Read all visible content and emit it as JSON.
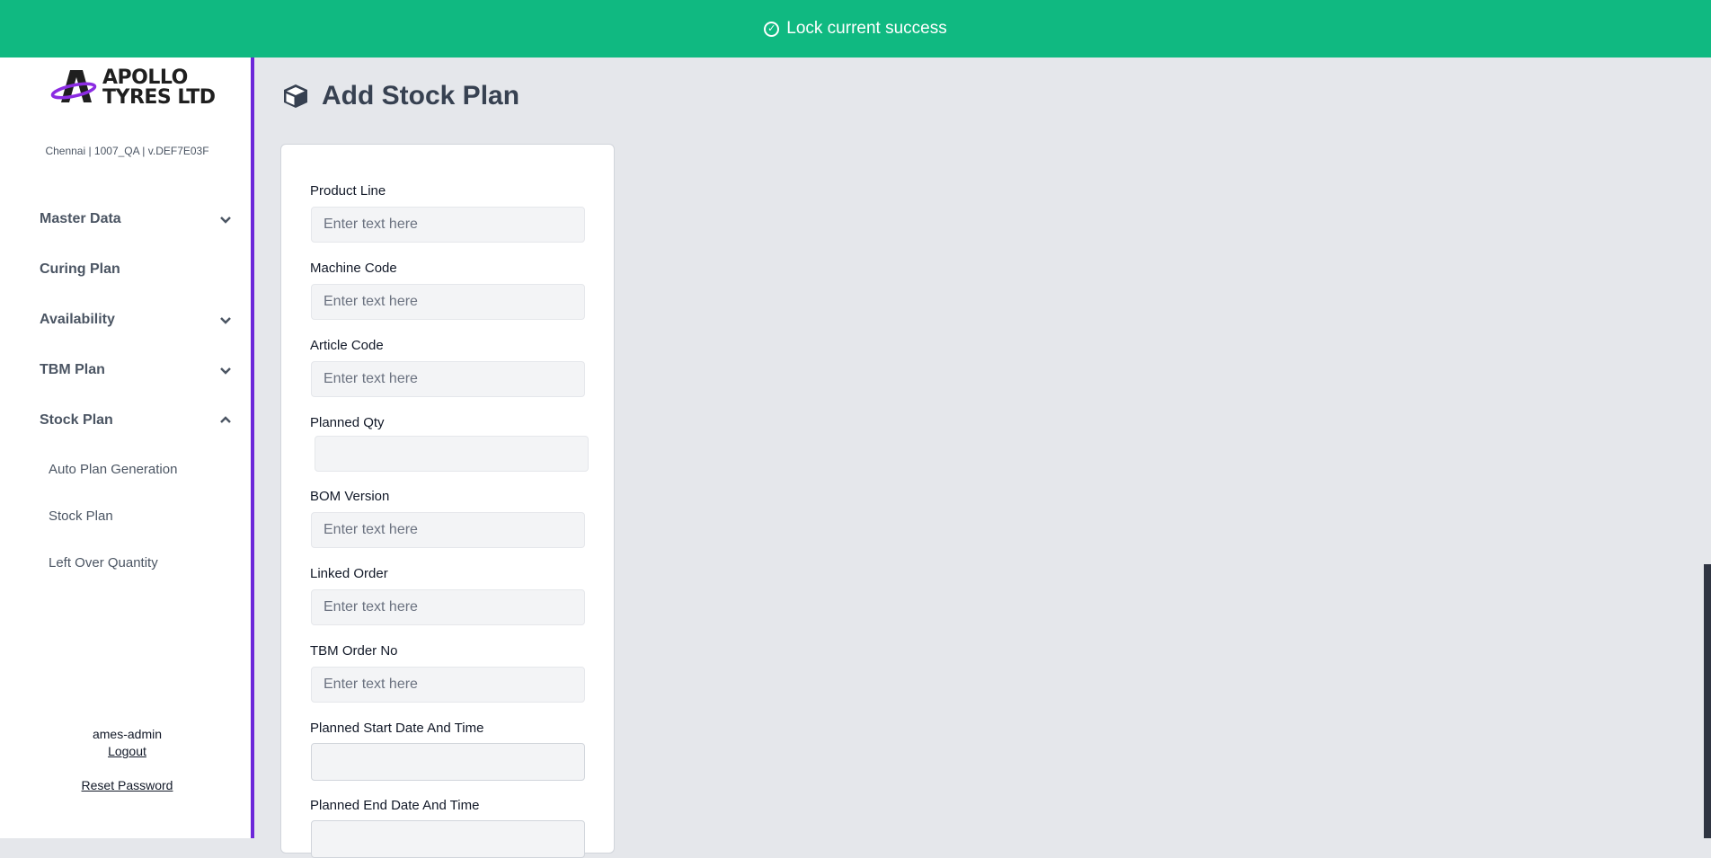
{
  "toast": {
    "message": "Lock current success",
    "icon": "check-circle-icon",
    "color": "#10b981"
  },
  "sidebar": {
    "logo_text_line1": "APOLLO",
    "logo_text_line2": "TYRES LTD",
    "site_info": "Chennai | 1007_QA | v.DEF7E03F",
    "accent_color": "#6d28d9",
    "nav": [
      {
        "label": "Master Data",
        "icon": "chevron-down-icon"
      },
      {
        "label": "Curing Plan"
      },
      {
        "label": "Availability",
        "icon": "chevron-down-icon"
      },
      {
        "label": "TBM Plan",
        "icon": "chevron-down-icon"
      },
      {
        "label": "Stock Plan",
        "icon": "chevron-up-icon"
      }
    ],
    "sub_items": [
      {
        "label": "Auto Plan Generation"
      },
      {
        "label": "Stock Plan"
      },
      {
        "label": "Left Over Quantity"
      }
    ],
    "user": {
      "name": "ames-admin",
      "logout": "Logout",
      "reset_password": "Reset Password"
    }
  },
  "main": {
    "title": "Add Stock Plan",
    "title_icon": "cube-icon",
    "form": {
      "fields": [
        {
          "label": "Product Line",
          "placeholder": "Enter text here",
          "value": ""
        },
        {
          "label": "Machine Code",
          "placeholder": "Enter text here",
          "value": ""
        },
        {
          "label": "Article Code",
          "placeholder": "Enter text here",
          "value": ""
        },
        {
          "label": "Planned Qty",
          "placeholder": "",
          "value": ""
        },
        {
          "label": "BOM Version",
          "placeholder": "Enter text here",
          "value": ""
        },
        {
          "label": "Linked Order",
          "placeholder": "Enter text here",
          "value": ""
        },
        {
          "label": "TBM Order No",
          "placeholder": "Enter text here",
          "value": ""
        },
        {
          "label": "Planned Start Date And Time",
          "placeholder": "",
          "value": ""
        },
        {
          "label": "Planned End Date And Time",
          "placeholder": "",
          "value": ""
        }
      ]
    }
  }
}
